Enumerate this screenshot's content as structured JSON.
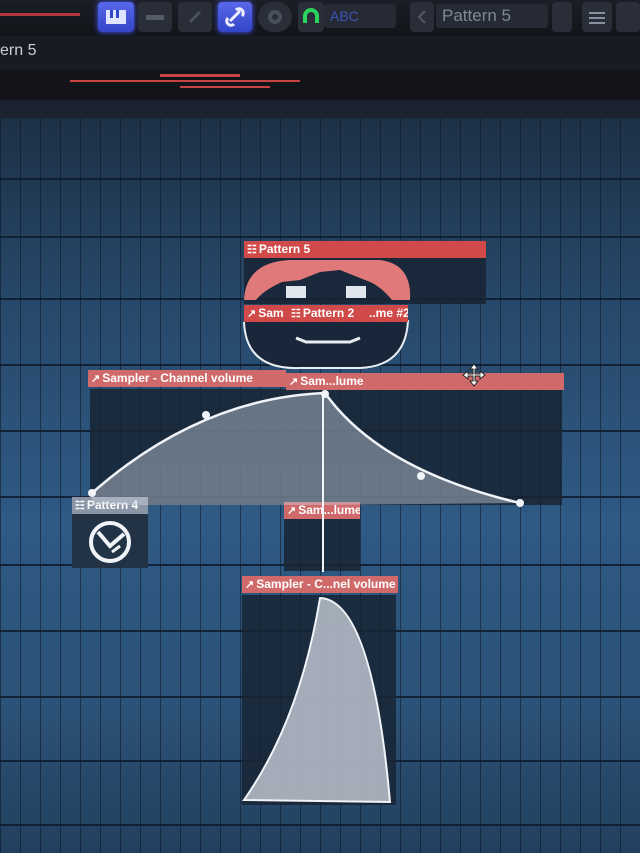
{
  "toolbar": {
    "pattern_selector": "Pattern 5",
    "tempo_field": "ABC"
  },
  "header": {
    "title": "ern 5"
  },
  "clips": {
    "pattern5_top": "Pattern 5",
    "sam_left": "Sam",
    "pattern2": "Pattern 2",
    "me2": "..me #2",
    "channel_volume_long": "Sampler - Channel volume",
    "sam_lume_a": "Sam...lume",
    "pattern4": "Pattern 4",
    "sam_lume_b": "Sam...lume",
    "channel_volume_short": "Sampler - C...nel volume"
  },
  "colors": {
    "clip_label_red": "#d14a4a",
    "automation_fill": "#b8c0cc",
    "grid_blue": "#2f5a84"
  }
}
